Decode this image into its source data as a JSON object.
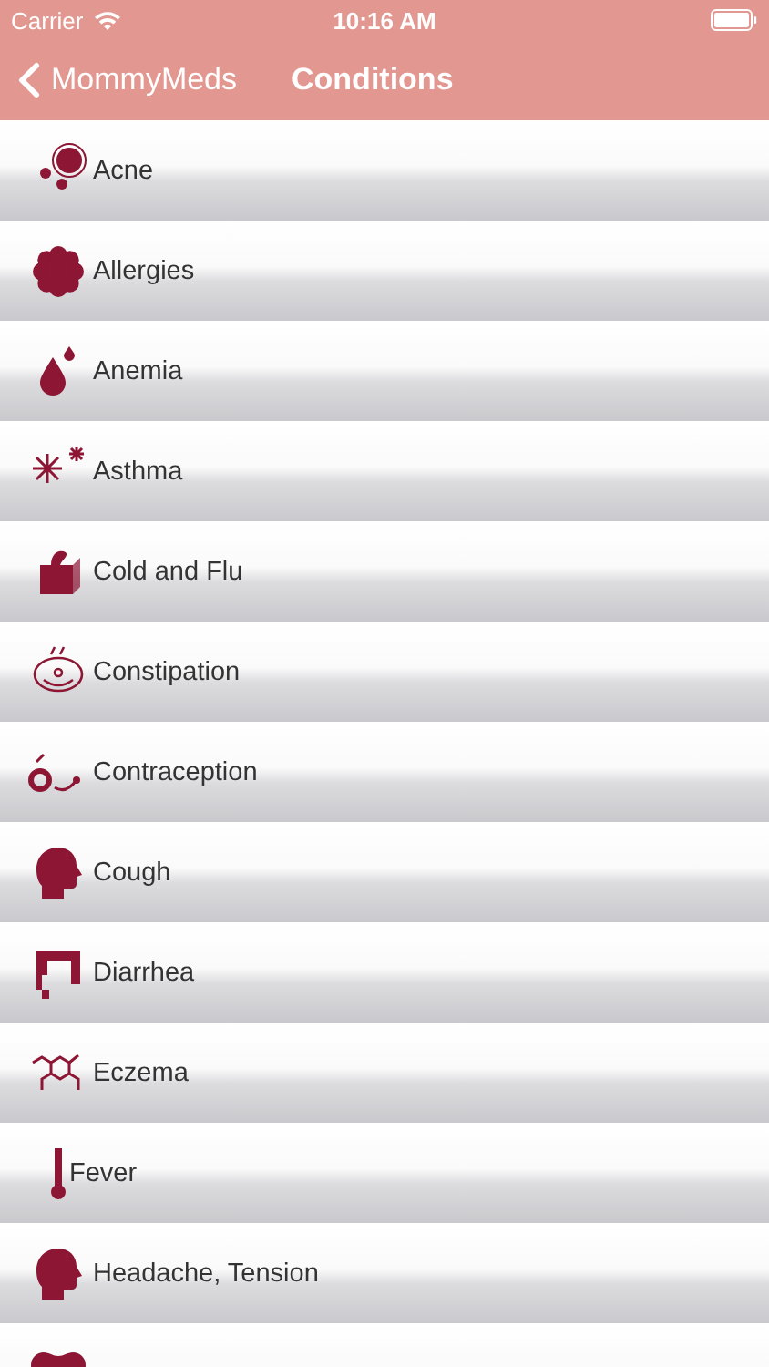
{
  "status_bar": {
    "carrier": "Carrier",
    "time": "10:16 AM"
  },
  "nav_bar": {
    "back": "MommyMeds",
    "title": "Conditions"
  },
  "conditions": [
    {
      "kind": "row",
      "label": "Acne"
    },
    {
      "kind": "row",
      "label": "Allergies"
    },
    {
      "kind": "row",
      "label": "Anemia"
    },
    {
      "kind": "row",
      "label": "Asthma"
    },
    {
      "kind": "row",
      "label": "Cold and Flu"
    },
    {
      "kind": "row",
      "label": "Constipation"
    },
    {
      "kind": "row",
      "label": "Contraception"
    },
    {
      "kind": "row",
      "label": "Cough"
    },
    {
      "kind": "row",
      "label": "Diarrhea"
    },
    {
      "kind": "row",
      "label": "Eczema"
    },
    {
      "kind": "row",
      "label": "Fever"
    },
    {
      "kind": "row",
      "label": "Headache, Tension"
    },
    {
      "kind": "cut-off"
    }
  ]
}
